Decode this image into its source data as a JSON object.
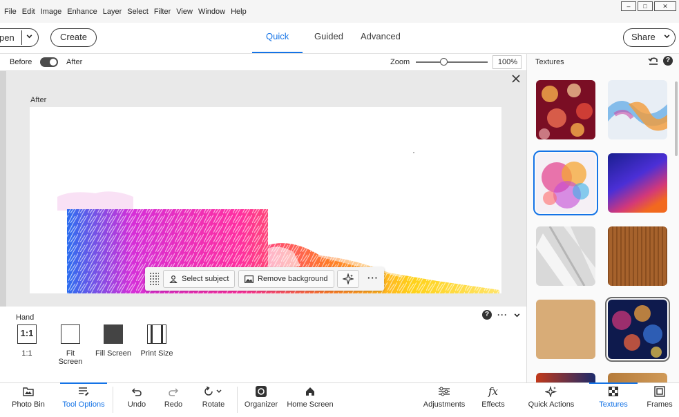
{
  "menu": [
    "File",
    "Edit",
    "Image",
    "Enhance",
    "Layer",
    "Select",
    "Filter",
    "View",
    "Window",
    "Help"
  ],
  "window_controls": [
    "minimize",
    "restore",
    "close"
  ],
  "header": {
    "open_label": "pen",
    "create_label": "Create",
    "modes": [
      "Quick",
      "Guided",
      "Advanced"
    ],
    "active_mode": "Quick",
    "share_label": "Share"
  },
  "viewbar": {
    "before_label": "Before",
    "after_label": "After",
    "zoom_label": "Zoom",
    "zoom_value": "100%",
    "zoom_slider_fraction": 0.35
  },
  "canvas": {
    "view_label": "After"
  },
  "action_bar": {
    "select_subject": "Select subject",
    "remove_background": "Remove background",
    "more": "···"
  },
  "tool_options": {
    "title": "Hand",
    "options": [
      {
        "label": "1:1",
        "icon": "one-to-one-icon"
      },
      {
        "label": "Fit Screen",
        "icon": "fit-screen-icon"
      },
      {
        "label": "Fill Screen",
        "icon": "fill-screen-icon"
      },
      {
        "label": "Print Size",
        "icon": "print-size-icon"
      }
    ]
  },
  "right_panel": {
    "title": "Textures",
    "selected_index": 2,
    "highlighted_index": 7,
    "thumbnails": [
      {
        "name": "bokeh-hearts-texture",
        "colors": [
          "#7a0e24",
          "#e34a3a",
          "#f7b04b"
        ]
      },
      {
        "name": "smoke-color-texture",
        "colors": [
          "#e8eef5",
          "#5aa7e6",
          "#f29b3a"
        ]
      },
      {
        "name": "powder-burst-texture",
        "colors": [
          "#f5f0f5",
          "#e23d8c",
          "#f6a733"
        ]
      },
      {
        "name": "blue-orange-gradient-texture",
        "colors": [
          "#1a1f8f",
          "#4b2fd6",
          "#f2691e"
        ]
      },
      {
        "name": "light-shadow-texture",
        "colors": [
          "#d9d9d9",
          "#f7f7f7",
          "#b5b5b5"
        ]
      },
      {
        "name": "wood-texture",
        "colors": [
          "#6b3812",
          "#b06a31",
          "#8a4b1c"
        ]
      },
      {
        "name": "paper-texture",
        "colors": [
          "#c99a63",
          "#deb482",
          "#c18d57"
        ]
      },
      {
        "name": "bokeh-lights-texture",
        "colors": [
          "#0e1a4d",
          "#d9377a",
          "#f1a23c"
        ]
      }
    ]
  },
  "taskbar": {
    "items": [
      {
        "label": "Photo Bin",
        "icon": "photo-bin-icon"
      },
      {
        "label": "Tool Options",
        "icon": "tool-options-icon",
        "active": true
      },
      {
        "label": "Undo",
        "icon": "undo-icon"
      },
      {
        "label": "Redo",
        "icon": "redo-icon"
      },
      {
        "label": "Rotate",
        "icon": "rotate-icon"
      },
      {
        "label": "Organizer",
        "icon": "organizer-icon"
      },
      {
        "label": "Home Screen",
        "icon": "home-icon"
      },
      {
        "label": "Adjustments",
        "icon": "adjustments-icon"
      },
      {
        "label": "Effects",
        "icon": "effects-icon"
      },
      {
        "label": "Quick Actions",
        "icon": "quick-actions-icon"
      },
      {
        "label": "Textures",
        "icon": "textures-icon",
        "active": true
      },
      {
        "label": "Frames",
        "icon": "frames-icon"
      }
    ]
  },
  "colors": {
    "accent": "#1473e6",
    "canvas_bg": "#e9e9e9"
  }
}
